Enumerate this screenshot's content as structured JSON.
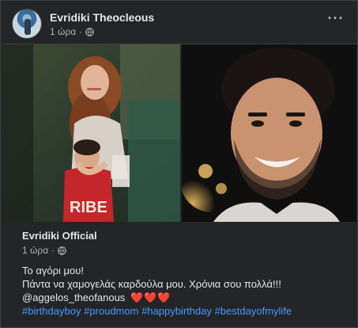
{
  "post": {
    "author": "Evridiki Theocleous",
    "time": "1 ώρα",
    "separator": "·",
    "more_label": "···"
  },
  "shared_post": {
    "author": "Evridiki Official",
    "time": "1 ώρα",
    "separator": "·",
    "caption_line1": "Το αγόρι μου!",
    "caption_line2": "Πάντα να χαμογελάς καρδούλα μου. Χρόνια σου πολλά!!!",
    "mention": "@aggelos_theofanous",
    "hearts": "❤️❤️❤️",
    "hashtags": [
      "#birthdayboy",
      "#proudmom",
      "#happybirthday",
      "#bestdayofmylife"
    ],
    "shirt_text": "RIBE"
  },
  "colors": {
    "background": "#242526",
    "text": "#e4e6eb",
    "secondary_text": "#b0b3b8",
    "link": "#4599ff"
  }
}
